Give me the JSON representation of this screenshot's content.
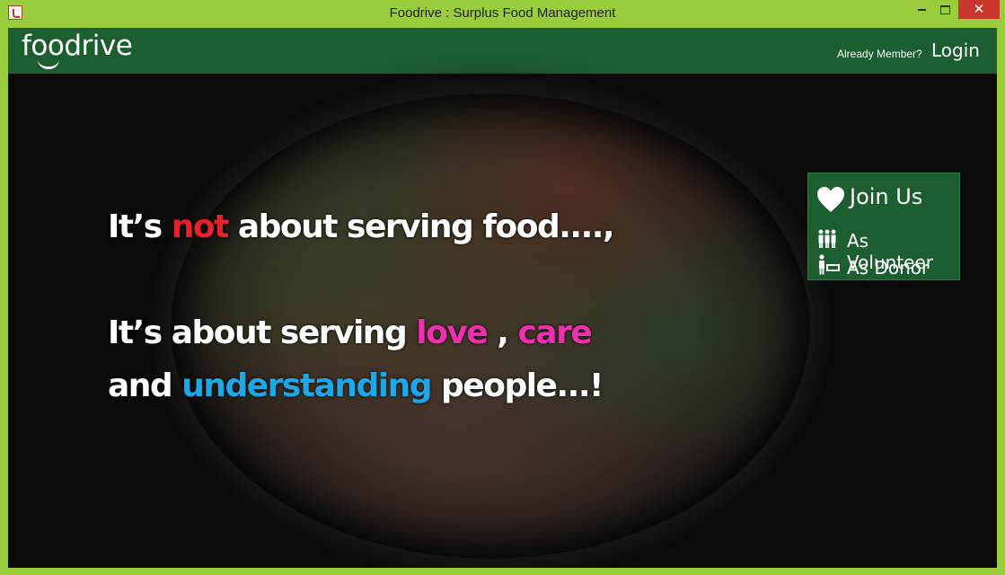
{
  "window": {
    "title": "Foodrive : Surplus Food Management",
    "close_label": "✕"
  },
  "header": {
    "logo": "foodrive",
    "member_prompt": "Already Member?",
    "login_label": "Login"
  },
  "hero": {
    "line1_pre": "It’s ",
    "line1_highlight": "not",
    "line1_post": " about serving food....,",
    "line2_pre": "It’s about serving ",
    "line2_love": "love",
    "line2_mid": " , ",
    "line2_care": "care",
    "line3_pre": "and ",
    "line3_understanding": "understanding",
    "line3_post": "  people...!"
  },
  "join_panel": {
    "title": "Join Us",
    "volunteer_label": "As Volunteer",
    "donor_label": "As Donor"
  },
  "colors": {
    "frame": "#9acd3c",
    "header_green": "#1c5e30",
    "highlight_red": "#e8202a",
    "highlight_pink": "#ee2fb0",
    "highlight_blue": "#1ea6e6"
  }
}
